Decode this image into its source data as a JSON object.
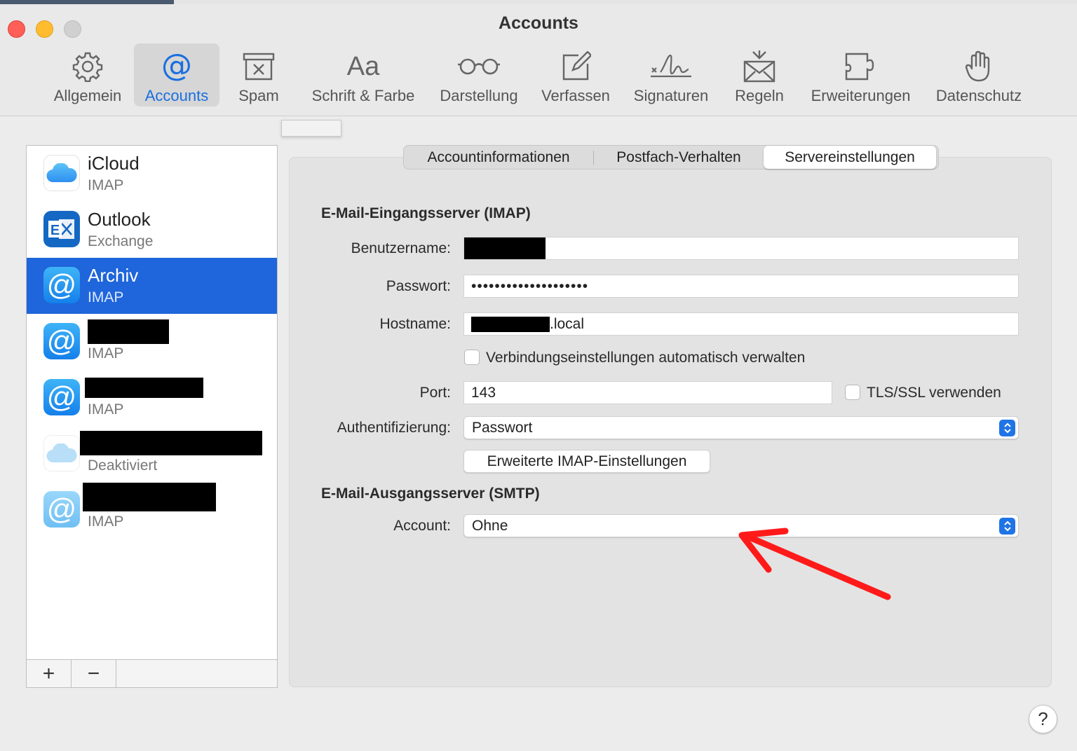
{
  "window": {
    "title": "Accounts"
  },
  "toolbar": {
    "items": [
      {
        "label": "Allgemein",
        "icon": "gear-icon"
      },
      {
        "label": "Accounts",
        "icon": "at-icon"
      },
      {
        "label": "Spam",
        "icon": "junk-box-icon"
      },
      {
        "label": "Schrift & Farbe",
        "icon": "font-icon"
      },
      {
        "label": "Darstellung",
        "icon": "glasses-icon"
      },
      {
        "label": "Verfassen",
        "icon": "compose-icon"
      },
      {
        "label": "Signaturen",
        "icon": "signature-icon"
      },
      {
        "label": "Regeln",
        "icon": "rules-envelope-icon"
      },
      {
        "label": "Erweiterungen",
        "icon": "puzzle-icon"
      },
      {
        "label": "Datenschutz",
        "icon": "hand-icon"
      }
    ],
    "font_icon_text": "Aa",
    "accent_color": "#1a6fe0"
  },
  "accounts": [
    {
      "name": "iCloud",
      "type": "IMAP",
      "icon": "icloud-icon"
    },
    {
      "name": "Outlook",
      "type": "Exchange",
      "icon": "exchange-icon"
    },
    {
      "name": "Archiv",
      "type": "IMAP",
      "icon": "at-icon",
      "selected": true
    },
    {
      "name": "",
      "type": "IMAP",
      "icon": "at-icon"
    },
    {
      "name": "",
      "type": "IMAP",
      "icon": "at-icon"
    },
    {
      "name": "",
      "type": "Deaktiviert",
      "icon": "icloud-icon"
    },
    {
      "name": "",
      "type": "IMAP",
      "icon": "at-icon"
    }
  ],
  "sidebar_buttons": {
    "add": "+",
    "remove": "−"
  },
  "tabs": [
    {
      "label": "Accountinformationen"
    },
    {
      "label": "Postfach-Verhalten"
    },
    {
      "label": "Servereinstellungen",
      "active": true
    }
  ],
  "incoming": {
    "title": "E-Mail-Eingangsserver (IMAP)",
    "username_label": "Benutzername:",
    "username_value": "",
    "password_label": "Passwort:",
    "password_value": "••••••••••••••••••••",
    "hostname_label": "Hostname:",
    "hostname_suffix": ".local",
    "auto_manage_label": "Verbindungseinstellungen automatisch verwalten",
    "auto_manage_checked": false,
    "port_label": "Port:",
    "port_value": "143",
    "tls_label": "TLS/SSL verwenden",
    "tls_checked": false,
    "auth_label": "Authentifizierung:",
    "auth_value": "Passwort",
    "advanced_button": "Erweiterte IMAP-Einstellungen"
  },
  "outgoing": {
    "title": "E-Mail-Ausgangsserver (SMTP)",
    "account_label": "Account:",
    "account_value": "Ohne"
  },
  "help": {
    "label": "?"
  },
  "annotation_color": "#ff1a1a"
}
